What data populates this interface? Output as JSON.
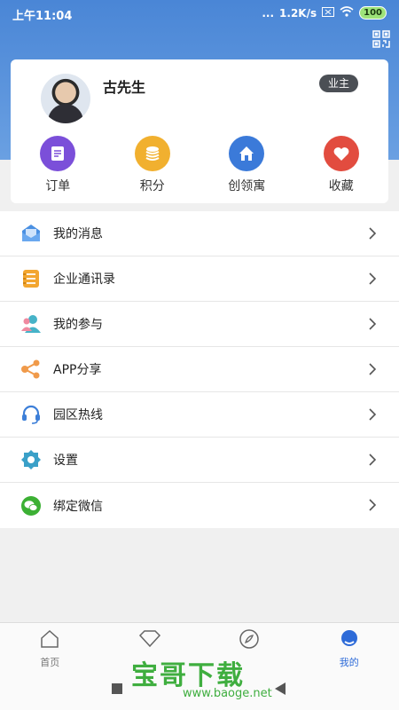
{
  "status": {
    "time": "上午11:04",
    "dots": "...",
    "speed": "1.2K/s",
    "battery": "100"
  },
  "profile": {
    "name": "古先生",
    "badge": "业主"
  },
  "quick": [
    {
      "label": "订单",
      "color": "#7b4fd9",
      "icon": "order-icon"
    },
    {
      "label": "积分",
      "color": "#f1b02f",
      "icon": "coins-icon"
    },
    {
      "label": "创领寓",
      "color": "#3b7ad9",
      "icon": "home-icon"
    },
    {
      "label": "收藏",
      "color": "#e24c3f",
      "icon": "heart-icon"
    }
  ],
  "menu": [
    {
      "label": "我的消息",
      "icon": "message-icon",
      "color": "#4a90e2"
    },
    {
      "label": "企业通讯录",
      "icon": "contacts-icon",
      "color": "#f3a630"
    },
    {
      "label": "我的参与",
      "icon": "participation-icon",
      "color": "#46b3c8"
    },
    {
      "label": "APP分享",
      "icon": "share-icon",
      "color": "#f09a4a"
    },
    {
      "label": "园区热线",
      "icon": "headset-icon",
      "color": "#3d7fd8"
    },
    {
      "label": "设置",
      "icon": "settings-icon",
      "color": "#3aa0c8"
    },
    {
      "label": "绑定微信",
      "icon": "wechat-icon",
      "color": "#3cb034"
    }
  ],
  "tabs": [
    {
      "label": "首页",
      "icon": "home-tab-icon"
    },
    {
      "label": "",
      "icon": "diamond-tab-icon"
    },
    {
      "label": "",
      "icon": "compass-tab-icon"
    },
    {
      "label": "我的",
      "icon": "profile-tab-icon"
    }
  ],
  "watermark": {
    "title": "宝哥下载",
    "url": "www.baoge.net"
  }
}
